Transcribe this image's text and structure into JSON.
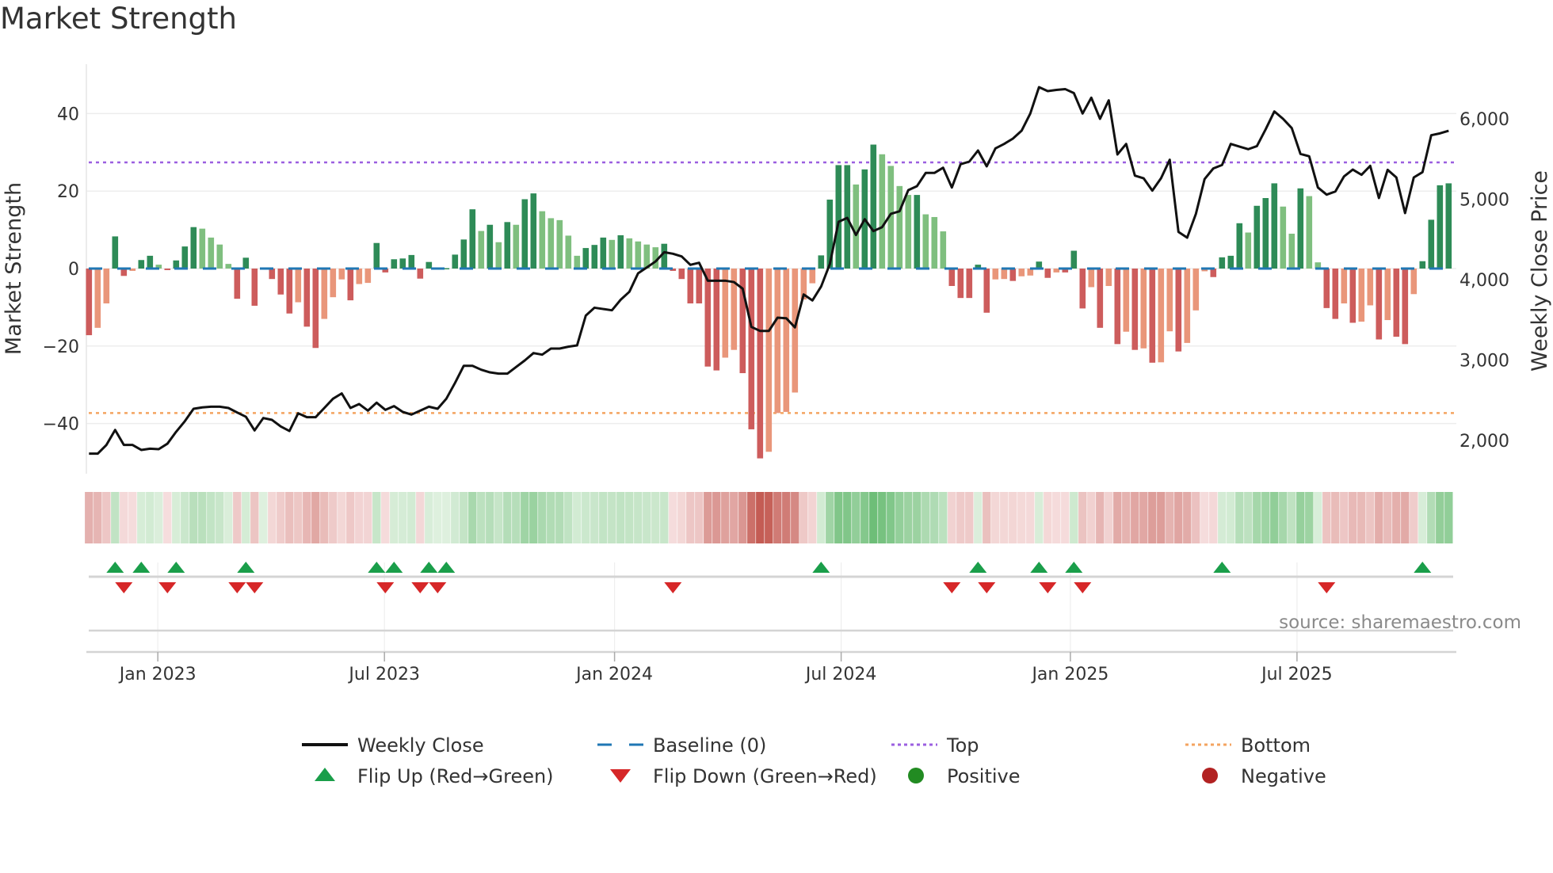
{
  "title": "Market Strength",
  "source": "source: sharemaestro.com",
  "colors": {
    "bar_pos_up": "#2e8b57",
    "bar_pos_down": "#7fbf7f",
    "bar_neg_down": "#cd5c5c",
    "bar_neg_up": "#e9967a",
    "line": "#111111",
    "baseline": "#1f77b4",
    "top": "#9b5fe0",
    "bottom": "#f4a460",
    "flip_up": "#1a9e4a",
    "flip_down": "#d62728",
    "positive": "#228b22",
    "negative": "#b22222"
  },
  "legend": [
    {
      "key": "weekly-close",
      "label": "Weekly Close"
    },
    {
      "key": "baseline",
      "label": "Baseline (0)"
    },
    {
      "key": "top",
      "label": "Top"
    },
    {
      "key": "bottom",
      "label": "Bottom"
    },
    {
      "key": "flip-up",
      "label": "Flip Up (Red→Green)"
    },
    {
      "key": "flip-down",
      "label": "Flip Down (Green→Red)"
    },
    {
      "key": "positive",
      "label": "Positive"
    },
    {
      "key": "negative",
      "label": "Negative"
    }
  ],
  "chart_data": {
    "type": "bar",
    "title": "Market Strength",
    "ylabel": "Market Strength",
    "y2label": "Weekly Close Price",
    "ylim": [
      -52,
      56
    ],
    "y2lim": [
      1580,
      6700
    ],
    "yticks": [
      "40",
      "20",
      "0",
      "−20",
      "−40"
    ],
    "ytick_values": [
      40,
      20,
      0,
      -20,
      -40
    ],
    "y2ticks": [
      "6,000",
      "5,000",
      "4,000",
      "3,000",
      "2,000"
    ],
    "y2tick_values": [
      6000,
      5000,
      4000,
      3000,
      2000
    ],
    "xticks": [
      {
        "label": "Jan 2023",
        "week": 7.9
      },
      {
        "label": "Jul 2023",
        "week": 33.9
      },
      {
        "label": "Jan 2024",
        "week": 60.3
      },
      {
        "label": "Jul 2024",
        "week": 86.3
      },
      {
        "label": "Jan 2025",
        "week": 112.6
      },
      {
        "label": "Jul 2025",
        "week": 138.6
      }
    ],
    "top_level": 27.4,
    "bottom_level": -37.3,
    "strength": [
      -17.2,
      -15.3,
      -9,
      8.3,
      -1.9,
      -0.6,
      2.2,
      3.3,
      1,
      -0.4,
      2.1,
      5.7,
      10.7,
      10.3,
      8,
      6.2,
      1.2,
      -7.8,
      2.8,
      -9.6,
      0,
      -2.7,
      -6.7,
      -11.6,
      -8.7,
      -15,
      -20.5,
      -13,
      -7.4,
      -2.8,
      -8.2,
      -4,
      -3.7,
      6.6,
      -1,
      2.4,
      2.6,
      3.5,
      -2.6,
      1.7,
      0,
      0.1,
      3.6,
      7.5,
      15.3,
      9.7,
      11.3,
      6.8,
      12,
      11.3,
      17.9,
      19.4,
      14.8,
      13,
      12.5,
      8.5,
      3.3,
      5.3,
      6.1,
      8,
      7.4,
      8.6,
      7.8,
      7,
      6.2,
      5.5,
      6.4,
      -0.6,
      -2.7,
      -9,
      -9,
      -25.3,
      -26.3,
      -23,
      -21,
      -27,
      -41.5,
      -49,
      -47.3,
      -37.3,
      -37,
      -32,
      -8,
      -3.8,
      3.4,
      17.8,
      26.7,
      26.7,
      21.7,
      25.6,
      32,
      29.5,
      26.5,
      21.3,
      19,
      19,
      14,
      13.3,
      9.6,
      -4.5,
      -7.6,
      -7.6,
      1,
      -11.4,
      -2.8,
      -2.7,
      -3.2,
      -2,
      -1.8,
      1.8,
      -2.4,
      -1,
      -1,
      4.6,
      -10.3,
      -4.8,
      -15.3,
      -4.5,
      -19.5,
      -16.3,
      -21,
      -20.6,
      -24.3,
      -24.2,
      -16.2,
      -21.4,
      -19.2,
      -10.8,
      -0.7,
      -2.2,
      2.9,
      3.3,
      11.7,
      9.3,
      16.2,
      18.2,
      22,
      16,
      9,
      20.7,
      18.7,
      1.6,
      -10.2,
      -13,
      -9,
      -14,
      -13.7,
      -9.5,
      -18.3,
      -13.3,
      -17.6,
      -19.5,
      -6.6,
      1.9,
      12.6,
      21.5,
      22
    ],
    "weekly_close": [
      1836,
      1836,
      1944,
      2131,
      1944,
      1944,
      1882,
      1898,
      1892,
      1960,
      2108,
      2240,
      2394,
      2411,
      2420,
      2420,
      2404,
      2348,
      2295,
      2125,
      2279,
      2256,
      2174,
      2118,
      2338,
      2289,
      2289,
      2404,
      2519,
      2585,
      2404,
      2453,
      2371,
      2470,
      2381,
      2427,
      2355,
      2322,
      2371,
      2420,
      2394,
      2519,
      2716,
      2929,
      2929,
      2880,
      2847,
      2831,
      2831,
      2913,
      2995,
      3087,
      3067,
      3143,
      3143,
      3166,
      3182,
      3553,
      3651,
      3635,
      3619,
      3750,
      3849,
      4079,
      4151,
      4226,
      4341,
      4322,
      4289,
      4184,
      4210,
      3987,
      3987,
      3987,
      3970,
      3888,
      3412,
      3362,
      3362,
      3527,
      3520,
      3406,
      3816,
      3741,
      3914,
      4194,
      4719,
      4768,
      4555,
      4752,
      4604,
      4653,
      4818,
      4850,
      5113,
      5163,
      5327,
      5327,
      5392,
      5146,
      5435,
      5468,
      5606,
      5409,
      5632,
      5688,
      5754,
      5852,
      6066,
      6394,
      6345,
      6360,
      6370,
      6320,
      6066,
      6263,
      6000,
      6230,
      5557,
      5688,
      5294,
      5261,
      5107,
      5261,
      5491,
      4594,
      4522,
      4818,
      5251,
      5383,
      5426,
      5688,
      5655,
      5622,
      5661,
      5869,
      6092,
      6000,
      5885,
      5563,
      5534,
      5146,
      5057,
      5096,
      5284,
      5369,
      5304,
      5415,
      5015,
      5366,
      5271,
      4828,
      5271,
      5337,
      5796,
      5819,
      5852
    ],
    "flip_up_weeks": [
      3,
      6,
      10,
      18,
      33,
      35,
      39,
      41,
      84,
      102,
      109,
      113,
      130,
      153
    ],
    "flip_down_weeks": [
      4,
      9,
      17,
      19,
      34,
      38,
      40,
      67,
      99,
      103,
      110,
      114,
      142
    ],
    "grid": true,
    "legend_position": "bottom"
  }
}
